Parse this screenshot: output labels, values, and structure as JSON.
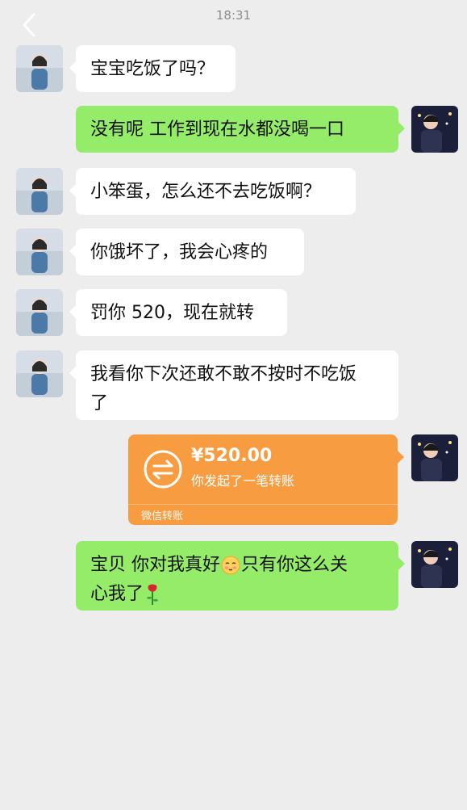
{
  "header": {
    "time": "18:31"
  },
  "messages": [
    {
      "text": "宝宝吃饭了吗？"
    },
    {
      "text": "没有呢 工作到现在水都没喝一口"
    },
    {
      "text": "小笨蛋，怎么还不去吃饭啊？"
    },
    {
      "text": "你饿坏了，我会心疼的"
    },
    {
      "text": "罚你 520，现在就转"
    },
    {
      "text_line1": "我看你下次还敢不敢不按时不吃饭",
      "text_line2": "了"
    },
    {
      "text_line1_a": "宝贝 你对我真好",
      "text_line1_b": "只有你这么关",
      "text_line2": "心我了"
    }
  ],
  "transfer": {
    "amount": "¥520.00",
    "desc": "你发起了一笔转账",
    "footer": "微信转账"
  },
  "colors": {
    "background": "#ededed",
    "incoming_bubble": "#ffffff",
    "outgoing_bubble": "#95ec69",
    "transfer": "#f79c41"
  },
  "icons": [
    "back-chevron-icon",
    "transfer-arrows-icon",
    "shy-face-emoji",
    "rose-emoji"
  ]
}
